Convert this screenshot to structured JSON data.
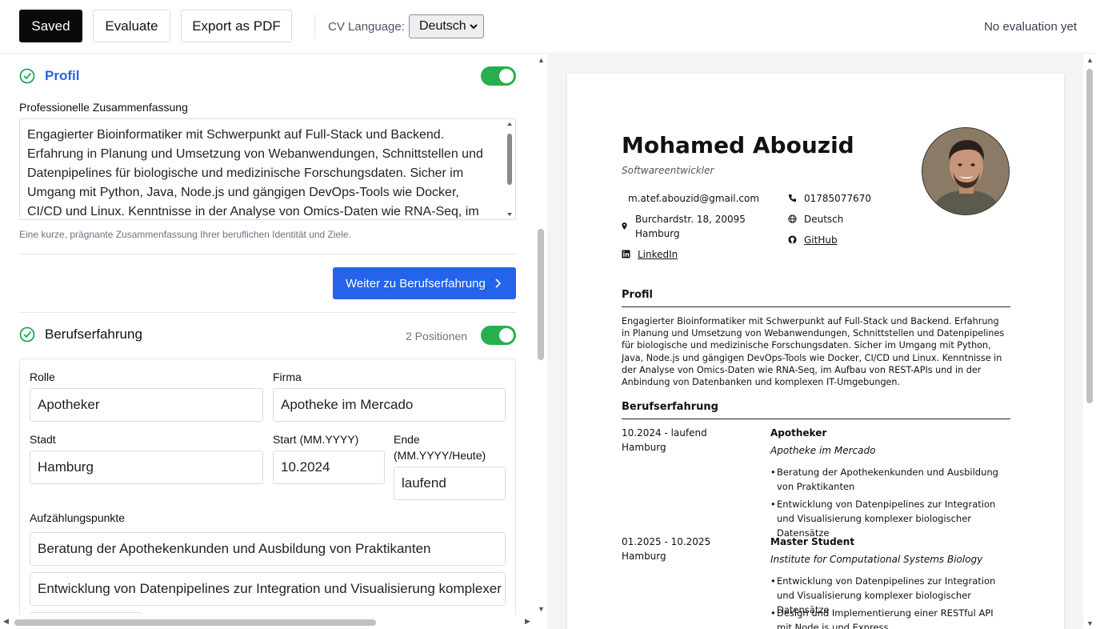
{
  "toolbar": {
    "saved_label": "Saved",
    "evaluate_label": "Evaluate",
    "export_label": "Export as PDF",
    "language_label": "CV Language:",
    "language_value": "Deutsch",
    "evaluation_status": "No evaluation yet"
  },
  "profile_section": {
    "title": "Profil",
    "enabled": true,
    "summary_label": "Professionelle Zusammenfassung",
    "summary_text": "Engagierter Bioinformatiker mit Schwerpunkt auf Full-Stack und Backend. Erfahrung in Planung und Umsetzung von Webanwendungen, Schnittstellen und Datenpipelines für biologische und medizinische Forschungsdaten. Sicher im Umgang mit Python, Java, Node.js und gängigen DevOps-Tools wie Docker, CI/CD und Linux. Kenntnisse in der Analyse von Omics-Daten wie RNA-Seq, im",
    "hint": "Eine kurze, prägnante Zusammenfassung Ihrer beruflichen Identität und Ziele.",
    "next_button": "Weiter zu Berufserfahrung"
  },
  "experience_section": {
    "title": "Berufserfahrung",
    "count_label": "2 Positionen",
    "enabled": true,
    "role_label": "Rolle",
    "role_value": "Apotheker",
    "company_label": "Firma",
    "company_value": "Apotheke im Mercado",
    "city_label": "Stadt",
    "city_value": "Hamburg",
    "start_label": "Start (MM.YYYY)",
    "start_value": "10.2024",
    "end_label_1": "Ende",
    "end_label_2": "(MM.YYYY/Heute)",
    "end_value": "laufend",
    "bullets_label": "Aufzählungspunkte",
    "bullet_1": "Beratung der Apothekenkunden und Ausbildung von Praktikanten",
    "bullet_2": "Entwicklung von Datenpipelines zur Integration und Visualisierung komplexer biologischer Datensätze"
  },
  "preview": {
    "name": "Mohamed Abouzid",
    "title": "Softwareentwickler",
    "email": "m.atef.abouzid@gmail.com",
    "phone": "01785077670",
    "address_1": "Burchardstr. 18, 20095",
    "address_2": "Hamburg",
    "language": "Deutsch",
    "linkedin": "LinkedIn",
    "github": "GitHub",
    "profile_heading": "Profil",
    "profile_text": "Engagierter Bioinformatiker mit Schwerpunkt auf Full-Stack und Backend. Erfahrung in Planung und Umsetzung von Webanwendungen, Schnittstellen und Datenpipelines für biologische und medizinische Forschungsdaten. Sicher im Umgang mit Python, Java, Node.js und gängigen DevOps-Tools wie Docker, CI/CD und Linux. Kenntnisse in der Analyse von Omics-Daten wie RNA-Seq, im Aufbau von REST-APIs und in der Anbindung von Datenbanken und komplexen IT-Umgebungen.",
    "experience_heading": "Berufserfahrung",
    "jobs": [
      {
        "dates": "10.2024 - laufend",
        "city": "Hamburg",
        "role": "Apotheker",
        "company": "Apotheke im Mercado",
        "bullets": [
          "Beratung der Apothekenkunden und Ausbildung von Praktikanten",
          "Entwicklung von Datenpipelines zur Integration und Visualisierung komplexer biologischer Datensätze"
        ]
      },
      {
        "dates": "01.2025 - 10.2025",
        "city": "Hamburg",
        "role": "Master Student",
        "company": "Institute for Computational Systems Biology",
        "bullets": [
          "Entwicklung von Datenpipelines zur Integration und Visualisierung komplexer biologischer Datensätze",
          "Design und Implementierung einer RESTful API mit Node.js und Express"
        ]
      }
    ]
  },
  "colors": {
    "accent_blue": "#2563eb",
    "toggle_green": "#27ae4f",
    "check_green": "#22a559"
  }
}
